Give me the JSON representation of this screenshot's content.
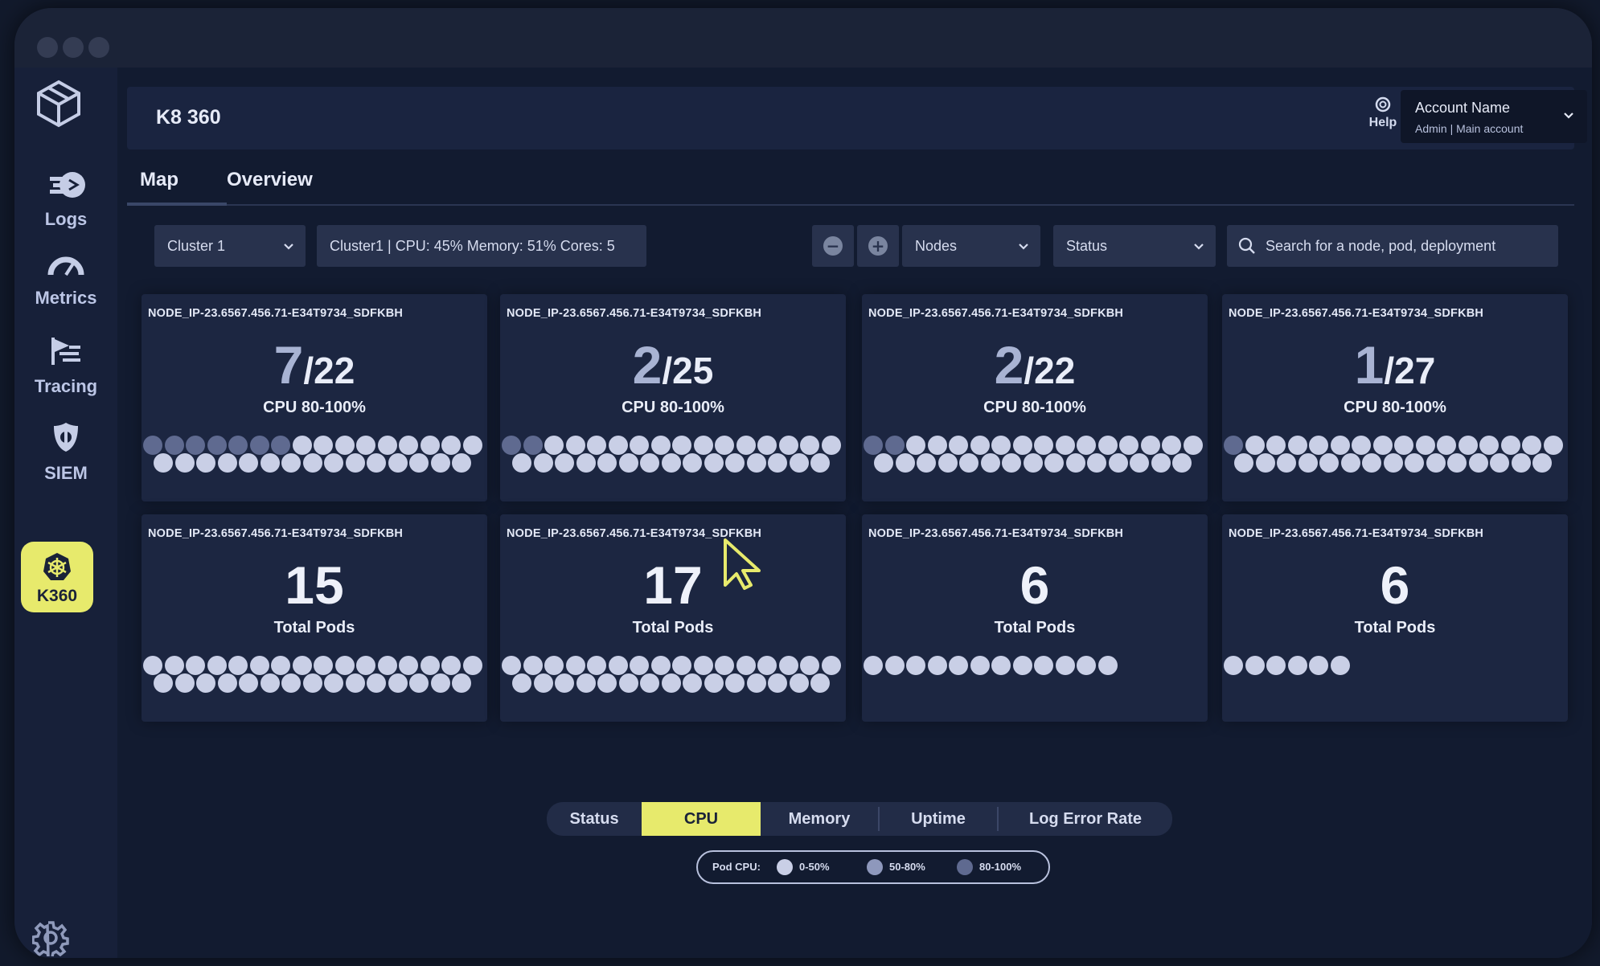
{
  "app": {
    "title": "K8 360"
  },
  "header": {
    "help_label": "Help",
    "account": {
      "name": "Account Name",
      "role": "Admin  |  Main account"
    }
  },
  "sidebar": {
    "items": [
      {
        "label": "Logs",
        "icon": "logs-icon"
      },
      {
        "label": "Metrics",
        "icon": "metrics-gauge-icon"
      },
      {
        "label": "Tracing",
        "icon": "tracing-icon"
      },
      {
        "label": "SIEM",
        "icon": "siem-shield-icon"
      },
      {
        "label": "K360",
        "icon": "kubernetes-wheel-icon",
        "active": true
      }
    ]
  },
  "tabs": [
    {
      "label": "Map",
      "active": true
    },
    {
      "label": "Overview",
      "active": false
    }
  ],
  "toolbar": {
    "cluster_select": "Cluster 1",
    "cluster_summary": "Cluster1 | CPU: 45%  Memory: 51%  Cores: 5",
    "view_select": "Nodes",
    "status_select": "Status",
    "search_placeholder": "Search for a node, pod, deployment"
  },
  "cards": [
    {
      "node": "NODE_IP-23.6567.456.71-E34T9734_SDFKBH",
      "num": "7",
      "den": "/22",
      "sub": "CPU 80-100%",
      "pod_count": 31,
      "hi_count": 7
    },
    {
      "node": "NODE_IP-23.6567.456.71-E34T9734_SDFKBH",
      "num": "2",
      "den": "/25",
      "sub": "CPU 80-100%",
      "pod_count": 31,
      "hi_count": 2
    },
    {
      "node": "NODE_IP-23.6567.456.71-E34T9734_SDFKBH",
      "num": "2",
      "den": "/22",
      "sub": "CPU 80-100%",
      "pod_count": 31,
      "hi_count": 2
    },
    {
      "node": "NODE_IP-23.6567.456.71-E34T9734_SDFKBH",
      "num": "1",
      "den": "/27",
      "sub": "CPU 80-100%",
      "pod_count": 31,
      "hi_count": 1
    },
    {
      "node": "NODE_IP-23.6567.456.71-E34T9734_SDFKBH",
      "num": "15",
      "den": "",
      "sub": "Total Pods",
      "pod_count": 31,
      "hi_count": 0
    },
    {
      "node": "NODE_IP-23.6567.456.71-E34T9734_SDFKBH",
      "num": "17",
      "den": "",
      "sub": "Total Pods",
      "pod_count": 31,
      "hi_count": 0
    },
    {
      "node": "NODE_IP-23.6567.456.71-E34T9734_SDFKBH",
      "num": "6",
      "den": "",
      "sub": "Total Pods",
      "pod_count": 12,
      "hi_count": 0
    },
    {
      "node": "NODE_IP-23.6567.456.71-E34T9734_SDFKBH",
      "num": "6",
      "den": "",
      "sub": "Total Pods",
      "pod_count": 6,
      "hi_count": 0
    }
  ],
  "bottom_tabs": [
    {
      "label": "Status",
      "active": false
    },
    {
      "label": "CPU",
      "active": true
    },
    {
      "label": "Memory",
      "active": false
    },
    {
      "label": "Uptime",
      "active": false
    },
    {
      "label": "Log Error Rate",
      "active": false
    }
  ],
  "legend": {
    "title": "Pod CPU:",
    "items": [
      {
        "label": "0-50%",
        "color": "#c9cfe6"
      },
      {
        "label": "50-80%",
        "color": "#8e98bc"
      },
      {
        "label": "80-100%",
        "color": "#5f6a90"
      }
    ]
  },
  "colors": {
    "accent": "#e7ea6c",
    "background": "#121b30",
    "card": "#1c2641"
  }
}
